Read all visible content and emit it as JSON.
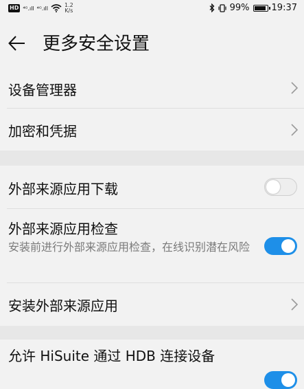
{
  "status_bar": {
    "hd_badge": "HD",
    "signal1": "⁴ᴳ.ıll",
    "signal2": "⁴ᴳ.ıll",
    "speed_value": "1.2",
    "speed_unit": "K/s",
    "battery_percent": "99%",
    "battery_level": 0.99,
    "time": "19:37"
  },
  "header": {
    "title": "更多安全设置"
  },
  "sections": {
    "device_admin": "设备管理器",
    "encryption": "加密和凭据",
    "external_download": "外部来源应用下载",
    "external_check": "外部来源应用检查",
    "external_check_desc": "安装前进行外部来源应用检查，在线识别潜在风险",
    "install_external": "安装外部来源应用",
    "hisuite_hdb": "允许 HiSuite 通过 HDB 连接设备"
  },
  "toggles": {
    "external_download": false,
    "external_check": true,
    "hisuite_hdb": true
  },
  "colors": {
    "accent": "#1e8fe8",
    "background": "#f2f2f2",
    "divider": "#dedede"
  }
}
